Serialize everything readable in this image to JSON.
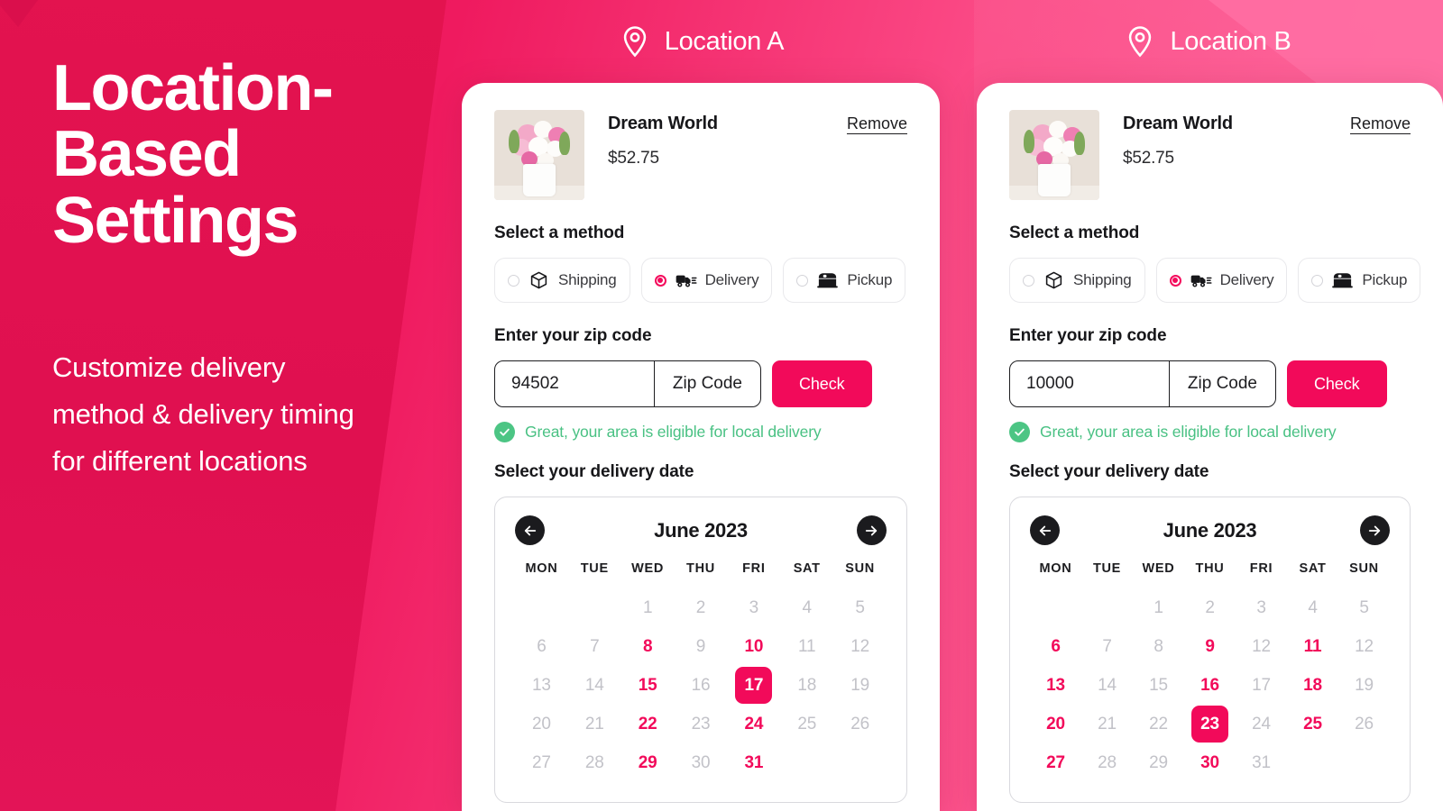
{
  "hero": {
    "title_lines": [
      "Location-",
      "Based",
      "Settings"
    ],
    "subtitle": "Customize delivery method & delivery timing for different locations"
  },
  "colors": {
    "brand_pink": "#f20a5a",
    "bg_dark_pink": "#e0104f",
    "bg_light_pink": "#fb4a86",
    "success_green": "#49c183",
    "muted_day": "#c2c2c8"
  },
  "locations": [
    {
      "header": {
        "label": "Location A",
        "icon": "map-pin-icon"
      },
      "product": {
        "name": "Dream World",
        "price": "$52.75",
        "remove_label": "Remove"
      },
      "method": {
        "label": "Select  a method",
        "options": [
          {
            "label": "Shipping",
            "icon": "box-icon",
            "selected": false
          },
          {
            "label": "Delivery",
            "icon": "truck-icon",
            "selected": true
          },
          {
            "label": "Pickup",
            "icon": "storefront-icon",
            "selected": false
          }
        ]
      },
      "zip": {
        "label": "Enter your zip code",
        "value": "94502",
        "placeholder": "94502",
        "suffix": "Zip Code",
        "button_label": "Check",
        "eligibility_text": "Great, your area is eligible for local delivery",
        "eligibility_icon": "check-circle-icon"
      },
      "calendar": {
        "label": "Select  your delivery date",
        "month_title": "June 2023",
        "prev_icon": "arrow-left-icon",
        "next_icon": "arrow-right-icon",
        "weekdays": [
          "MON",
          "TUE",
          "WED",
          "THU",
          "FRI",
          "SAT",
          "SUN"
        ],
        "weeks": [
          [
            {
              "n": "",
              "s": "empty"
            },
            {
              "n": "",
              "s": "empty"
            },
            {
              "n": "1",
              "s": "off"
            },
            {
              "n": "2",
              "s": "off"
            },
            {
              "n": "3",
              "s": "off"
            },
            {
              "n": "4",
              "s": "off"
            },
            {
              "n": "5",
              "s": "off"
            }
          ],
          [
            {
              "n": "6",
              "s": "off"
            },
            {
              "n": "7",
              "s": "off"
            },
            {
              "n": "8",
              "s": "avail"
            },
            {
              "n": "9",
              "s": "off"
            },
            {
              "n": "10",
              "s": "avail"
            },
            {
              "n": "11",
              "s": "off"
            },
            {
              "n": "12",
              "s": "off"
            }
          ],
          [
            {
              "n": "13",
              "s": "off"
            },
            {
              "n": "14",
              "s": "off"
            },
            {
              "n": "15",
              "s": "avail"
            },
            {
              "n": "16",
              "s": "off"
            },
            {
              "n": "17",
              "s": "sel"
            },
            {
              "n": "18",
              "s": "off"
            },
            {
              "n": "19",
              "s": "off"
            }
          ],
          [
            {
              "n": "20",
              "s": "off"
            },
            {
              "n": "21",
              "s": "off"
            },
            {
              "n": "22",
              "s": "avail"
            },
            {
              "n": "23",
              "s": "off"
            },
            {
              "n": "24",
              "s": "avail"
            },
            {
              "n": "25",
              "s": "off"
            },
            {
              "n": "26",
              "s": "off"
            }
          ],
          [
            {
              "n": "27",
              "s": "off"
            },
            {
              "n": "28",
              "s": "off"
            },
            {
              "n": "29",
              "s": "avail"
            },
            {
              "n": "30",
              "s": "off"
            },
            {
              "n": "31",
              "s": "avail"
            },
            {
              "n": "",
              "s": "empty"
            },
            {
              "n": "",
              "s": "empty"
            }
          ]
        ]
      }
    },
    {
      "header": {
        "label": "Location B",
        "icon": "map-pin-icon"
      },
      "product": {
        "name": "Dream World",
        "price": "$52.75",
        "remove_label": "Remove"
      },
      "method": {
        "label": "Select  a method",
        "options": [
          {
            "label": "Shipping",
            "icon": "box-icon",
            "selected": false
          },
          {
            "label": "Delivery",
            "icon": "truck-icon",
            "selected": true
          },
          {
            "label": "Pickup",
            "icon": "storefront-icon",
            "selected": false
          }
        ]
      },
      "zip": {
        "label": "Enter your zip code",
        "value": "10000",
        "placeholder": "10000",
        "suffix": "Zip Code",
        "button_label": "Check",
        "eligibility_text": "Great, your area is eligible for local delivery",
        "eligibility_icon": "check-circle-icon"
      },
      "calendar": {
        "label": "Select  your delivery date",
        "month_title": "June 2023",
        "prev_icon": "arrow-left-icon",
        "next_icon": "arrow-right-icon",
        "weekdays": [
          "MON",
          "TUE",
          "WED",
          "THU",
          "FRI",
          "SAT",
          "SUN"
        ],
        "weeks": [
          [
            {
              "n": "",
              "s": "empty"
            },
            {
              "n": "",
              "s": "empty"
            },
            {
              "n": "1",
              "s": "off"
            },
            {
              "n": "2",
              "s": "off"
            },
            {
              "n": "3",
              "s": "off"
            },
            {
              "n": "4",
              "s": "off"
            },
            {
              "n": "5",
              "s": "off"
            }
          ],
          [
            {
              "n": "6",
              "s": "avail"
            },
            {
              "n": "7",
              "s": "off"
            },
            {
              "n": "8",
              "s": "off"
            },
            {
              "n": "9",
              "s": "avail"
            },
            {
              "n": "12",
              "s": "off"
            },
            {
              "n": "11",
              "s": "avail"
            },
            {
              "n": "12",
              "s": "off"
            }
          ],
          [
            {
              "n": "13",
              "s": "avail"
            },
            {
              "n": "14",
              "s": "off"
            },
            {
              "n": "15",
              "s": "off"
            },
            {
              "n": "16",
              "s": "avail"
            },
            {
              "n": "17",
              "s": "off"
            },
            {
              "n": "18",
              "s": "avail"
            },
            {
              "n": "19",
              "s": "off"
            }
          ],
          [
            {
              "n": "20",
              "s": "avail"
            },
            {
              "n": "21",
              "s": "off"
            },
            {
              "n": "22",
              "s": "off"
            },
            {
              "n": "23",
              "s": "sel"
            },
            {
              "n": "24",
              "s": "off"
            },
            {
              "n": "25",
              "s": "avail"
            },
            {
              "n": "26",
              "s": "off"
            }
          ],
          [
            {
              "n": "27",
              "s": "avail"
            },
            {
              "n": "28",
              "s": "off"
            },
            {
              "n": "29",
              "s": "off"
            },
            {
              "n": "30",
              "s": "avail"
            },
            {
              "n": "31",
              "s": "off"
            },
            {
              "n": "",
              "s": "empty"
            },
            {
              "n": "",
              "s": "empty"
            }
          ]
        ]
      }
    }
  ]
}
